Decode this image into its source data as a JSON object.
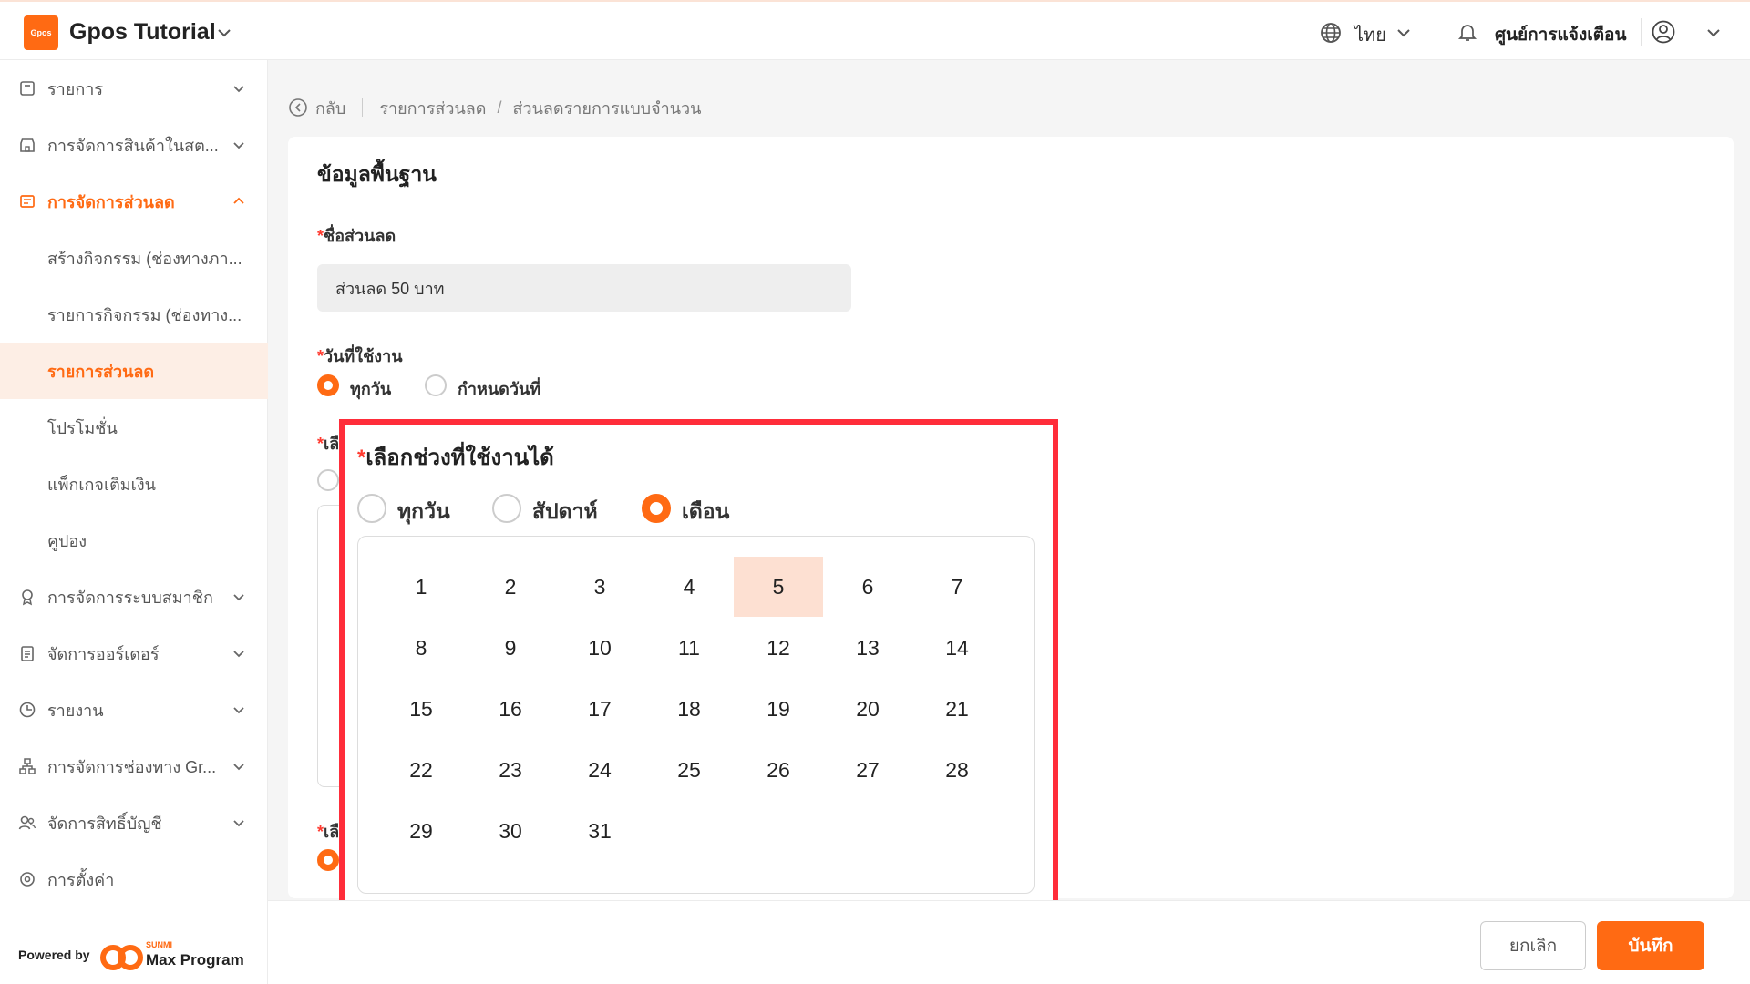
{
  "header": {
    "logo_text": "Gpos",
    "app_title": "Gpos Tutorial",
    "language": "ไทย",
    "notifications_label": "ศูนย์การแจ้งเตือน"
  },
  "sidebar": {
    "items": [
      {
        "label": "รายการ",
        "icon": "receipt-icon"
      },
      {
        "label": "การจัดการสินค้าในสต...",
        "icon": "store-icon"
      },
      {
        "label": "การจัดการส่วนลด",
        "icon": "discount-icon",
        "expanded": true
      },
      {
        "label": "การจัดการระบบสมาชิก",
        "icon": "member-icon"
      },
      {
        "label": "จัดการออร์เดอร์",
        "icon": "order-icon"
      },
      {
        "label": "รายงาน",
        "icon": "report-icon"
      },
      {
        "label": "การจัดการช่องทาง Gr...",
        "icon": "channel-icon"
      },
      {
        "label": "จัดการสิทธิ์บัญชี",
        "icon": "account-icon"
      },
      {
        "label": "การตั้งค่า",
        "icon": "settings-icon"
      }
    ],
    "subitems": [
      {
        "label": "สร้างกิจกรรม (ช่องทางภา..."
      },
      {
        "label": "รายการกิจกรรม (ช่องทาง..."
      },
      {
        "label": "รายการส่วนลด",
        "selected": true
      },
      {
        "label": "โปรโมชั่น"
      },
      {
        "label": "แพ็กเกจเติมเงิน"
      },
      {
        "label": "คูปอง"
      }
    ],
    "powered_by": "Powered by",
    "brand_sub": "SUNMI",
    "brand_name": "Max Program"
  },
  "breadcrumb": {
    "back": "กลับ",
    "parent": "รายการส่วนลด",
    "current": "ส่วนลดรายการแบบจำนวน"
  },
  "form": {
    "section_title": "ข้อมูลพื้นฐาน",
    "name_label": "ชื่อส่วนลด",
    "name_value": "ส่วนลด 50 บาท",
    "date_label": "วันที่ใช้งาน",
    "date_options": [
      "ทุกวัน",
      "กำหนดวันที่"
    ],
    "date_selected": "ทุกวัน",
    "partial_label_1": "เลื",
    "partial_label_2": "เลื"
  },
  "period_panel": {
    "title": "เลือกช่วงที่ใช้งานได้",
    "options": [
      "ทุกวัน",
      "สัปดาห์",
      "เดือน"
    ],
    "selected": "เดือน",
    "days": [
      1,
      2,
      3,
      4,
      5,
      6,
      7,
      8,
      9,
      10,
      11,
      12,
      13,
      14,
      15,
      16,
      17,
      18,
      19,
      20,
      21,
      22,
      23,
      24,
      25,
      26,
      27,
      28,
      29,
      30,
      31
    ],
    "selected_day": 5
  },
  "footer": {
    "cancel": "ยกเลิก",
    "save": "บันทึก"
  },
  "colors": {
    "accent": "#ff6a13",
    "highlight": "#ff2d3a",
    "selected_day_bg": "#fde0d2"
  }
}
